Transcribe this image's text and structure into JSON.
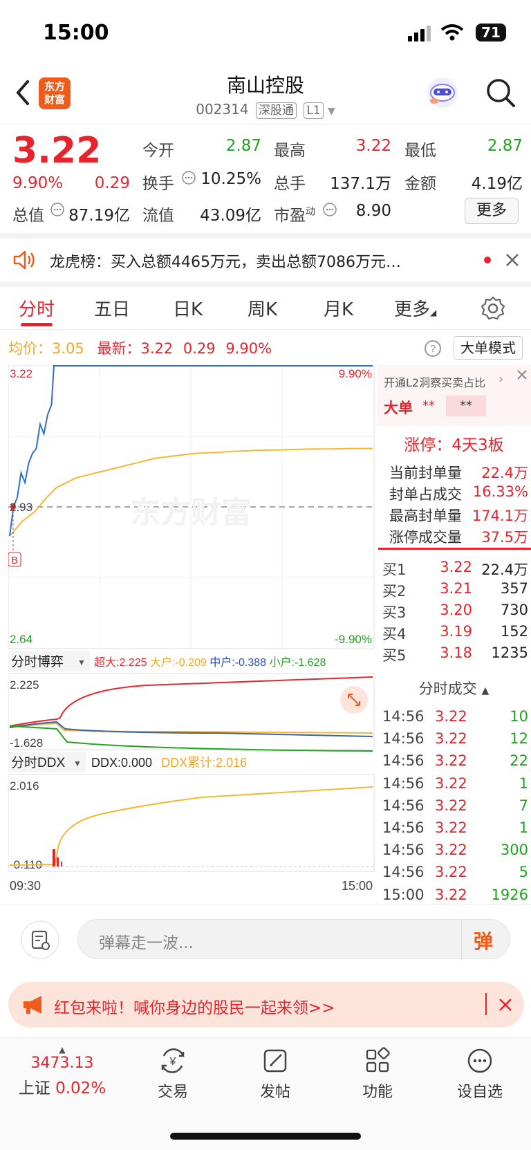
{
  "status": {
    "time": "15:00",
    "battery": "71"
  },
  "header": {
    "logo_line1": "东方",
    "logo_line2": "财富",
    "name": "南山控股",
    "code": "002314",
    "market_tag": "深股通",
    "level_tag": "L1"
  },
  "quote": {
    "price": "3.22",
    "change_pct": "9.90%",
    "change": "0.29",
    "open_label": "今开",
    "open": "2.87",
    "high_label": "最高",
    "high": "3.22",
    "low_label": "最低",
    "low": "2.87",
    "turnover_label": "换手",
    "turnover": "10.25%",
    "volume_label": "总手",
    "volume": "137.1万",
    "amount_label": "金额",
    "amount": "4.19亿",
    "mktcap_label": "总值",
    "mktcap": "87.19亿",
    "float_label": "流值",
    "float": "43.09亿",
    "pe_label": "市盈",
    "pe_sup": "动",
    "pe": "8.90",
    "more_label": "更多"
  },
  "notice": {
    "text": "龙虎榜：买入总额4465万元，卖出总额7086万元…"
  },
  "tabs": [
    "分时",
    "五日",
    "日K",
    "周K",
    "月K",
    "更多"
  ],
  "chart_info": {
    "avg_label": "均价：",
    "avg": "3.05",
    "latest_label": "最新：",
    "latest": "3.22",
    "latest_change": "0.29",
    "latest_pct": "9.90%",
    "mode_button": "大单模式"
  },
  "chart_data": {
    "type": "line",
    "price_axis": {
      "top": "3.22",
      "mid": "2.93",
      "bottom": "2.64",
      "top_pct": "9.90%",
      "bottom_pct": "-9.90%"
    },
    "time_axis": {
      "start": "09:30",
      "end": "15:00"
    },
    "marker": "B",
    "watermark": "东方财富",
    "price_series": [
      2.87,
      2.93,
      2.95,
      3.0,
      2.98,
      3.02,
      3.04,
      3.05,
      3.1,
      3.08,
      3.12,
      3.14,
      3.22,
      3.22,
      3.22,
      3.22,
      3.22,
      3.22,
      3.22,
      3.22,
      3.22
    ],
    "avg_series": [
      2.87,
      2.9,
      2.92,
      2.95,
      2.97,
      2.99,
      3.0,
      3.01,
      3.02,
      3.03,
      3.035,
      3.04,
      3.042,
      3.044,
      3.046,
      3.047,
      3.048,
      3.049,
      3.049,
      3.05,
      3.05
    ],
    "ylim": [
      2.64,
      3.22
    ],
    "game": {
      "title": "分时博弈",
      "super_label": "超大:",
      "super_val": "2.225",
      "large_label": "大户:",
      "large_val": "-0.209",
      "mid_label": "中户:",
      "mid_val": "-0.388",
      "small_label": "小户:",
      "small_val": "-1.628",
      "axis_top": "2.225",
      "axis_bottom": "-1.628"
    },
    "ddx": {
      "title": "分时DDX",
      "ddx_label": "DDX:",
      "ddx_val": "0.000",
      "sum_label": "DDX累计:",
      "sum_val": "2.016",
      "axis_top": "2.016",
      "axis_bottom": "-0.110"
    }
  },
  "side": {
    "promo": "开通L2洞察买卖占比",
    "big_label": "大单",
    "big_val1": "**",
    "big_val2": "**",
    "limit_label": "涨停：",
    "limit_text": "4天3板",
    "stats": [
      {
        "label": "当前封单量",
        "value": "22.4万"
      },
      {
        "label": "封单占成交",
        "value": "16.33%"
      },
      {
        "label": "最高封单量",
        "value": "174.1万"
      },
      {
        "label": "涨停成交量",
        "value": "37.5万"
      }
    ],
    "bids": [
      {
        "label": "买1",
        "price": "3.22",
        "vol": "22.4万"
      },
      {
        "label": "买2",
        "price": "3.21",
        "vol": "357"
      },
      {
        "label": "买3",
        "price": "3.20",
        "vol": "730"
      },
      {
        "label": "买4",
        "price": "3.19",
        "vol": "152"
      },
      {
        "label": "买5",
        "price": "3.18",
        "vol": "1235"
      }
    ],
    "ticks_title": "分时成交",
    "ticks": [
      {
        "t": "14:56",
        "p": "3.22",
        "v": "10"
      },
      {
        "t": "14:56",
        "p": "3.22",
        "v": "12"
      },
      {
        "t": "14:56",
        "p": "3.22",
        "v": "22"
      },
      {
        "t": "14:56",
        "p": "3.22",
        "v": "1"
      },
      {
        "t": "14:56",
        "p": "3.22",
        "v": "7"
      },
      {
        "t": "14:56",
        "p": "3.22",
        "v": "1"
      },
      {
        "t": "14:56",
        "p": "3.22",
        "v": "300"
      },
      {
        "t": "14:56",
        "p": "3.22",
        "v": "5"
      },
      {
        "t": "15:00",
        "p": "3.22",
        "v": "1926"
      }
    ]
  },
  "bottom": {
    "placeholder": "弹幕走一波...",
    "danmu_btn": "弹"
  },
  "redpack": {
    "text": "红包来啦！喊你身边的股民一起来领>>"
  },
  "nav": {
    "index_value": "3473.13",
    "index_name": "上证",
    "index_pct": "0.02%",
    "items": [
      "交易",
      "发帖",
      "功能",
      "设自选"
    ]
  }
}
